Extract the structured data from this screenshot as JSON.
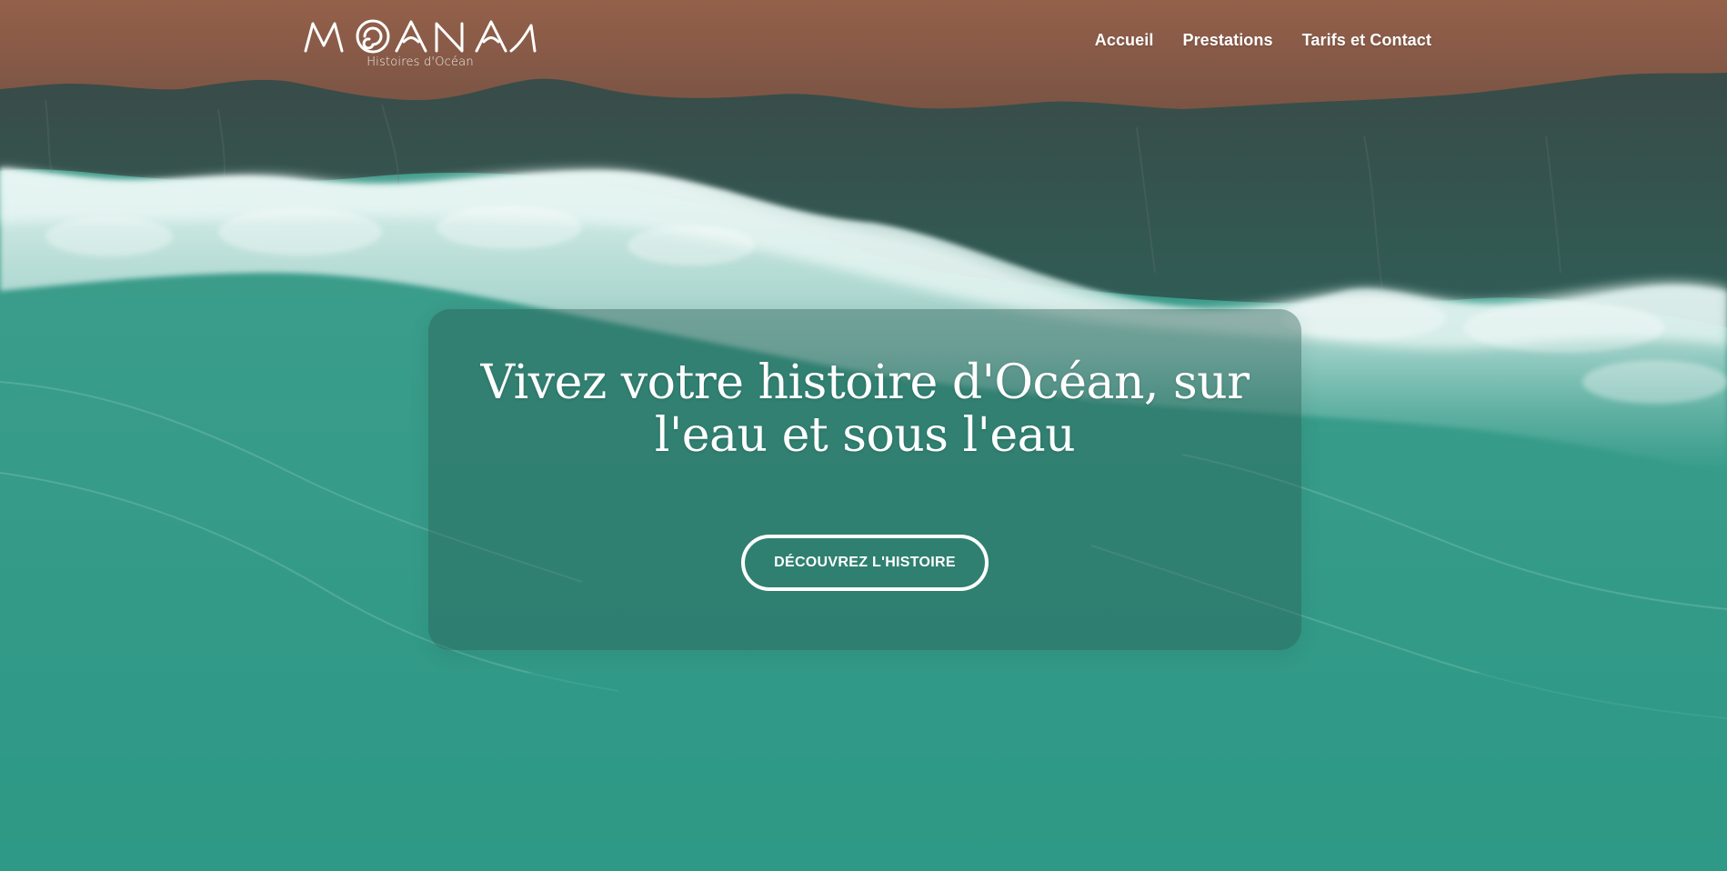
{
  "brand": {
    "name": "MOANA",
    "tagline": "Histoires d'Océan"
  },
  "nav": {
    "items": [
      {
        "label": "Accueil"
      },
      {
        "label": "Prestations"
      },
      {
        "label": "Tarifs et Contact"
      }
    ]
  },
  "hero": {
    "title": "Vivez votre histoire d'Océan, sur l'eau et sous l'eau",
    "cta_label": "DÉCOUVREZ L'HISTOIRE"
  },
  "colors": {
    "sand": "#8a5a45",
    "deep_water": "#2c5f58",
    "foam": "#d8f0ec",
    "lagoon": "#319b89",
    "text": "#ffffff"
  }
}
